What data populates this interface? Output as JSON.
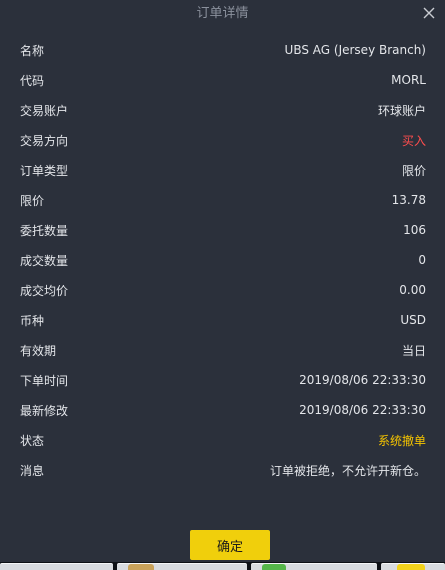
{
  "dialog": {
    "title": "订单详情",
    "close_icon": "close-icon",
    "confirm_label": "确定"
  },
  "colors": {
    "background": "#2b303b",
    "buy": "#ff4d4d",
    "status": "#f5c400",
    "button": "#f0cf0c"
  },
  "rows": [
    {
      "label": "名称",
      "value": "UBS AG (Jersey Branch)"
    },
    {
      "label": "代码",
      "value": "MORL"
    },
    {
      "label": "交易账户",
      "value": "环球账户"
    },
    {
      "label": "交易方向",
      "value": "买入"
    },
    {
      "label": "订单类型",
      "value": "限价"
    },
    {
      "label": "限价",
      "value": "13.78"
    },
    {
      "label": "委托数量",
      "value": "106"
    },
    {
      "label": "成交数量",
      "value": "0"
    },
    {
      "label": "成交均价",
      "value": "0.00"
    },
    {
      "label": "币种",
      "value": "USD"
    },
    {
      "label": "有效期",
      "value": "当日"
    },
    {
      "label": "下单时间",
      "value": "2019/08/06 22:33:30"
    },
    {
      "label": "最新修改",
      "value": "2019/08/06 22:33:30"
    },
    {
      "label": "状态",
      "value": "系统撤单"
    },
    {
      "label": "消息",
      "value": "订单被拒绝，不允许开新仓。"
    }
  ]
}
